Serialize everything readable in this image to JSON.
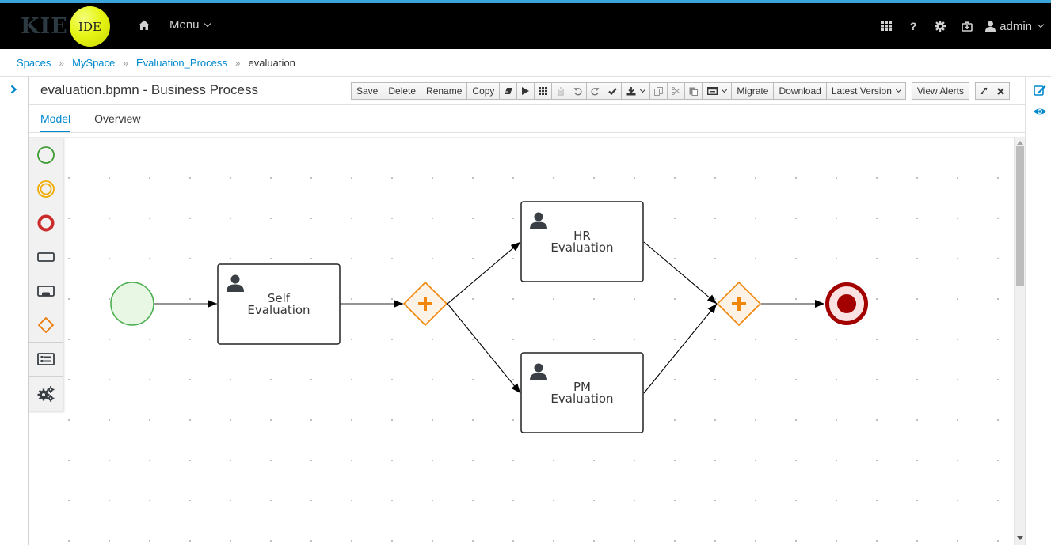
{
  "app": {
    "brand_left": "KIE",
    "brand_right": "IDE",
    "menu_label": "Menu",
    "user_label": "admin",
    "nav_icons": [
      "apps-grid-icon",
      "help-icon",
      "settings-gear-icon",
      "briefcase-icon"
    ],
    "help_glyph": "?"
  },
  "breadcrumb": {
    "items": [
      "Spaces",
      "MySpace",
      "Evaluation_Process"
    ],
    "current": "evaluation",
    "separator": "»"
  },
  "editor": {
    "title": "evaluation.bpmn - Business Process",
    "toolbar": {
      "save": "Save",
      "delete": "Delete",
      "rename": "Rename",
      "copy": "Copy",
      "migrate": "Migrate",
      "download": "Download",
      "latest_version": "Latest Version",
      "view_alerts": "View Alerts"
    },
    "tabs": [
      {
        "label": "Model",
        "active": true
      },
      {
        "label": "Overview",
        "active": false
      }
    ]
  },
  "palette": {
    "items": [
      "start-events",
      "intermediate-events",
      "end-events",
      "activities",
      "subprocesses",
      "gateways",
      "containers",
      "service-tasks"
    ]
  },
  "diagram": {
    "nodes": {
      "start": {
        "type": "start-event"
      },
      "self_eval": {
        "type": "user-task",
        "line1": "Self",
        "line2": "Evaluation"
      },
      "split": {
        "type": "parallel-gateway"
      },
      "hr_eval": {
        "type": "user-task",
        "line1": "HR",
        "line2": "Evaluation"
      },
      "pm_eval": {
        "type": "user-task",
        "line1": "PM",
        "line2": "Evaluation"
      },
      "join": {
        "type": "parallel-gateway"
      },
      "end": {
        "type": "end-event"
      }
    },
    "flows": [
      [
        "start",
        "self_eval"
      ],
      [
        "self_eval",
        "split"
      ],
      [
        "split",
        "hr_eval"
      ],
      [
        "split",
        "pm_eval"
      ],
      [
        "hr_eval",
        "join"
      ],
      [
        "pm_eval",
        "join"
      ],
      [
        "join",
        "end"
      ]
    ]
  },
  "colors": {
    "accent": "#0088ce",
    "start_stroke": "#4caf50",
    "start_fill": "#e8f7e4",
    "gateway": "#f0860a",
    "gateway_fill": "#fdf2e6",
    "end_stroke": "#a30000",
    "end_fill": "#fbe2e2"
  }
}
